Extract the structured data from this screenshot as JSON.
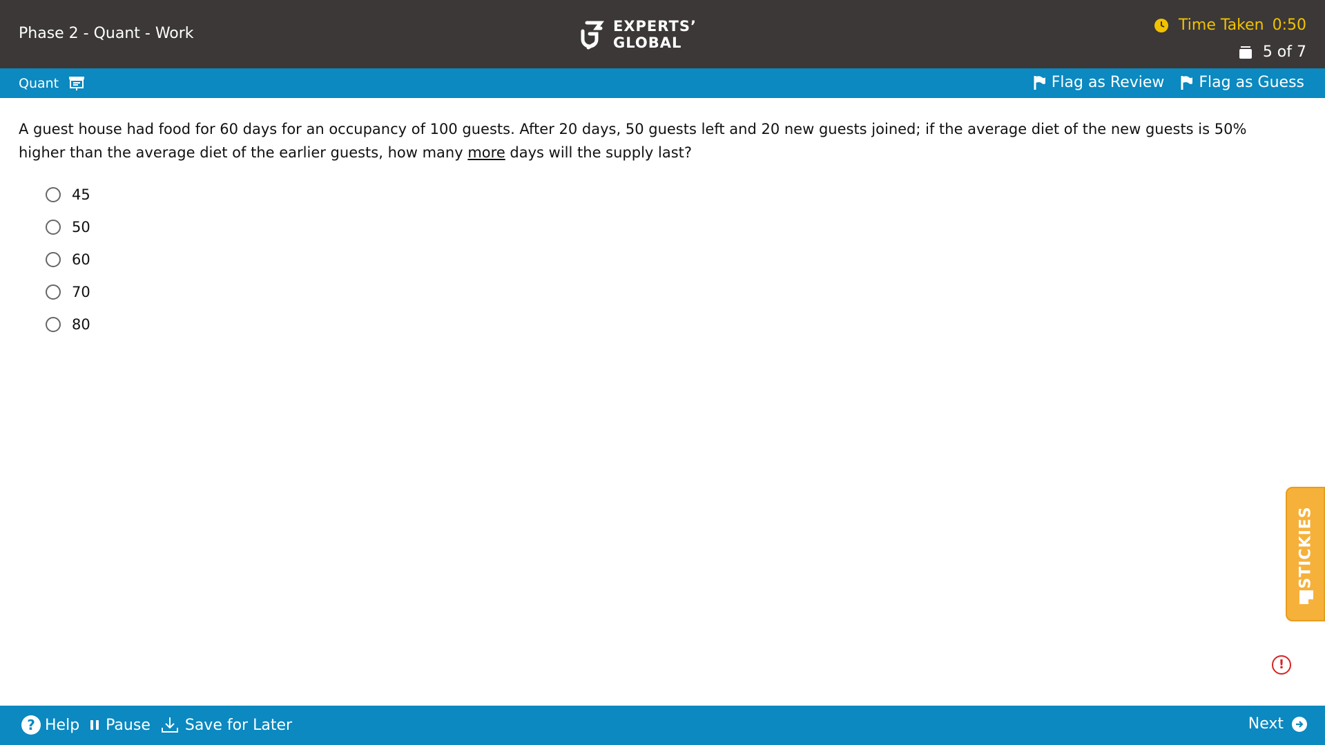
{
  "header": {
    "title": "Phase 2 - Quant - Work",
    "logo_line1": "EXPERTS’",
    "logo_line2": "GLOBAL",
    "time_label": "Time Taken",
    "time_value": "0:50",
    "counter": "5 of 7"
  },
  "subbar": {
    "section": "Quant",
    "flag_review": "Flag as Review",
    "flag_guess": "Flag as Guess"
  },
  "question": {
    "text_before": "A guest house had food for 60 days for an occupancy of 100 guests. After 20 days, 50 guests left and 20 new guests joined; if the average diet of the new guests is 50% higher than the average diet of the earlier guests, how many ",
    "underlined": "more",
    "text_after": " days will the supply last?",
    "options": [
      "45",
      "50",
      "60",
      "70",
      "80"
    ]
  },
  "stickies": {
    "label": "STICKIES"
  },
  "alert": {
    "symbol": "!"
  },
  "footer": {
    "help": "Help",
    "help_symbol": "?",
    "pause": "Pause",
    "save": "Save for Later",
    "next": "Next"
  },
  "colors": {
    "top_bar": "#3b3837",
    "accent_bar": "#0b89c0",
    "timer": "#f2c200",
    "stickies": "#f6b13a",
    "alert": "#d62424"
  }
}
